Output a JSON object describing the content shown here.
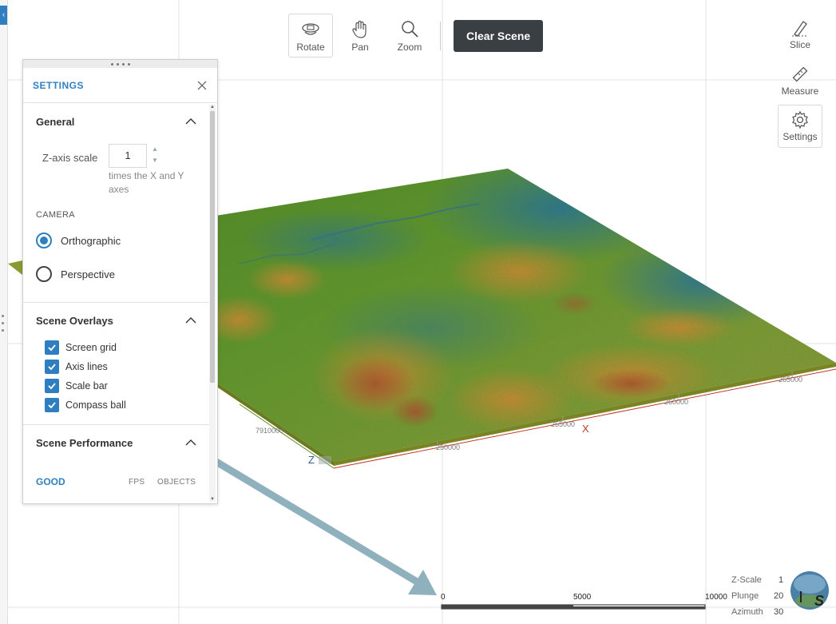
{
  "toolbar": {
    "rotate_label": "Rotate",
    "pan_label": "Pan",
    "zoom_label": "Zoom",
    "clear_label": "Clear Scene"
  },
  "right_tools": {
    "slice_label": "Slice",
    "measure_label": "Measure",
    "settings_label": "Settings"
  },
  "settings": {
    "title": "SETTINGS",
    "general": {
      "heading": "General",
      "z_label": "Z-axis scale",
      "z_value": "1",
      "z_help": "times the X and Y axes"
    },
    "camera": {
      "heading": "CAMERA",
      "options": [
        "Orthographic",
        "Perspective"
      ],
      "selected": "Orthographic"
    },
    "overlays": {
      "heading": "Scene Overlays",
      "items": [
        "Screen grid",
        "Axis lines",
        "Scale bar",
        "Compass ball"
      ]
    },
    "performance": {
      "heading": "Scene Performance",
      "status": "GOOD",
      "fps_label": "FPS",
      "objects_label": "OBJECTS"
    }
  },
  "axes": {
    "x_label": "X",
    "z_label": "Z",
    "x_ticks": [
      "250000",
      "255000",
      "260000",
      "265000"
    ],
    "y_tick": "7910000"
  },
  "scale_bar": {
    "labels": [
      "0",
      "5000",
      "10000"
    ]
  },
  "view_info": {
    "zscale_label": "Z-Scale",
    "zscale_value": "1",
    "plunge_label": "Plunge",
    "plunge_value": "20",
    "azimuth_label": "Azimuth",
    "azimuth_value": "30"
  },
  "compass": {
    "letter": "S"
  },
  "colors": {
    "accent": "#2f7fc0",
    "button_dark": "#3a3f44",
    "terrain_low": "#2a6a8c",
    "terrain_mid": "#5a8f2a",
    "terrain_high": "#c98a3a",
    "terrain_peak": "#b2492c",
    "annotation_arrow": "#8fb0bd",
    "axis_x": "#c0392b"
  }
}
